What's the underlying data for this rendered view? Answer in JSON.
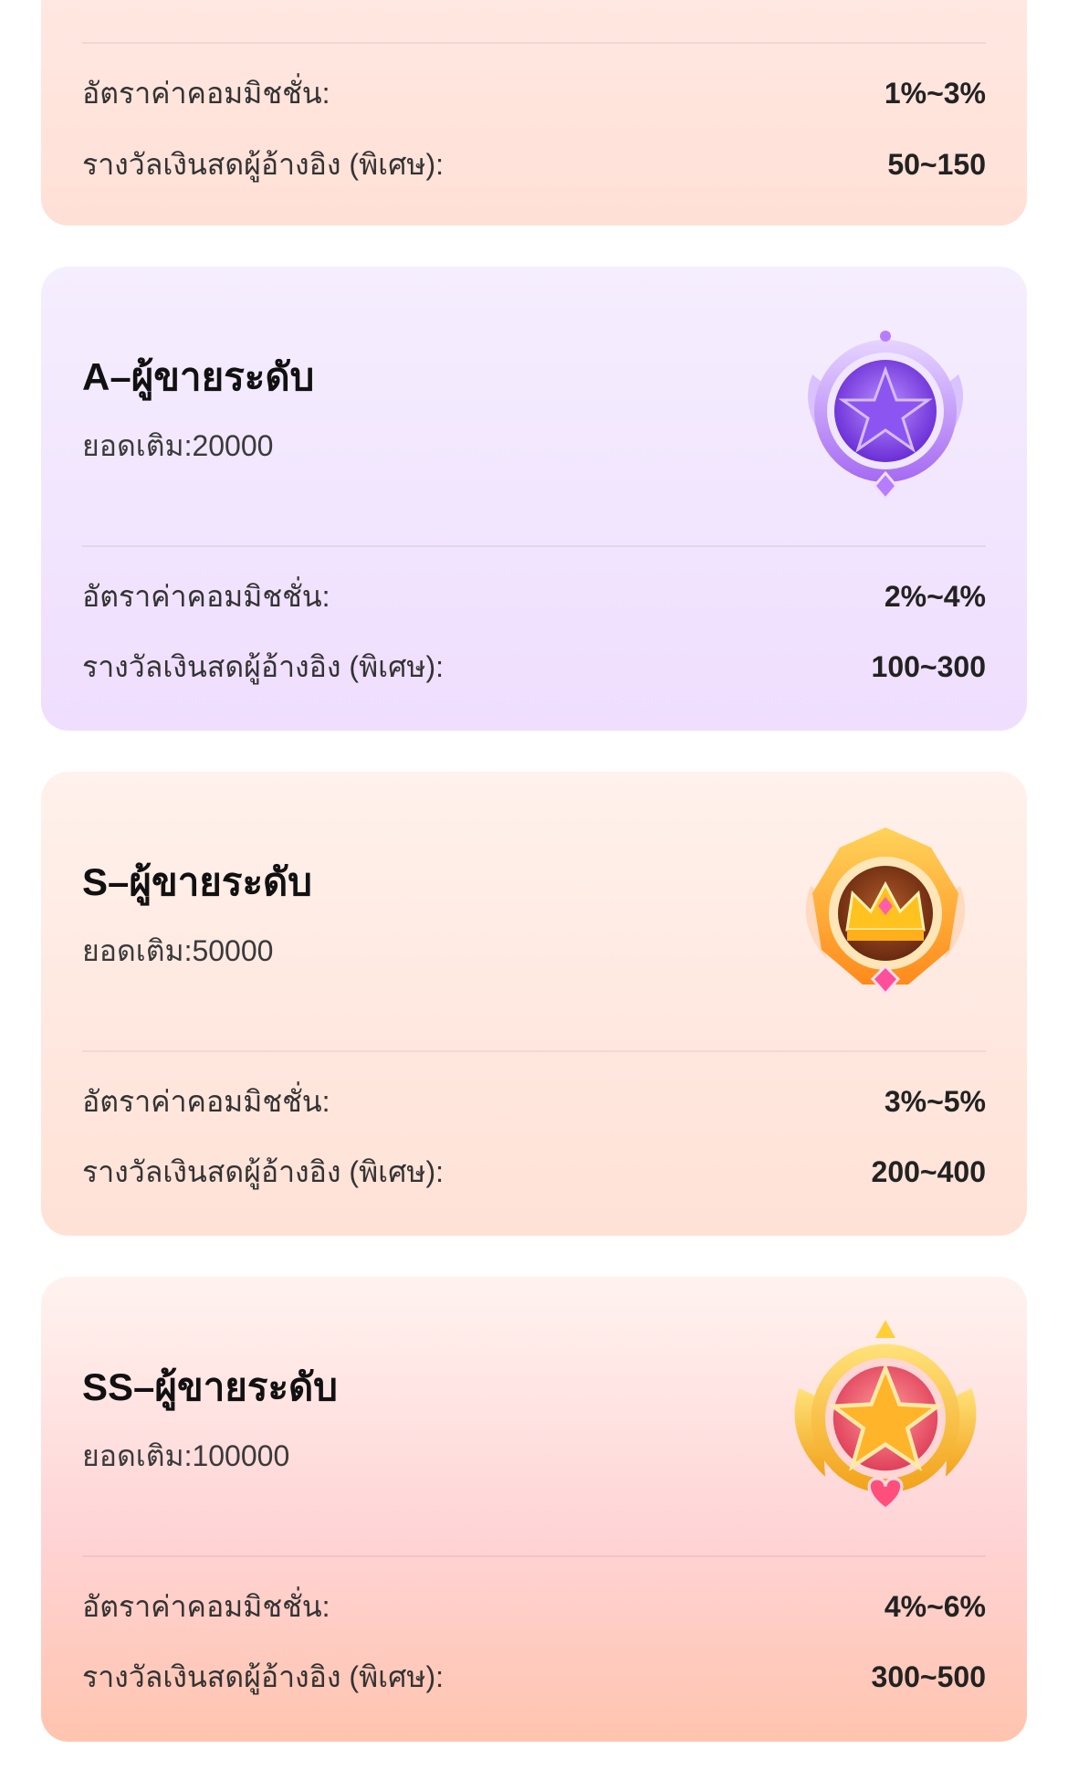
{
  "labels": {
    "commission": "อัตราค่าคอมมิชชั่น:",
    "referral": "รางวัลเงินสดผู้อ้างอิง (พิเศษ):"
  },
  "cards": [
    {
      "commission_value": "1%~3%",
      "referral_value": "50~150"
    },
    {
      "title": "A–ผู้ขายระดับ",
      "recharge": "ยอดเติม:20000",
      "badge_icon": "purple-star-badge",
      "commission_value": "2%~4%",
      "referral_value": "100~300"
    },
    {
      "title": "S–ผู้ขายระดับ",
      "recharge": "ยอดเติม:50000",
      "badge_icon": "gold-crown-badge",
      "commission_value": "3%~5%",
      "referral_value": "200~400"
    },
    {
      "title": "SS–ผู้ขายระดับ",
      "recharge": "ยอดเติม:100000",
      "badge_icon": "gold-star-badge",
      "commission_value": "4%~6%",
      "referral_value": "300~500"
    }
  ],
  "colors": {
    "purple_card": "#efdefe",
    "peach_card": "#ffe1d6",
    "pink_card": "#ffc4ae"
  }
}
